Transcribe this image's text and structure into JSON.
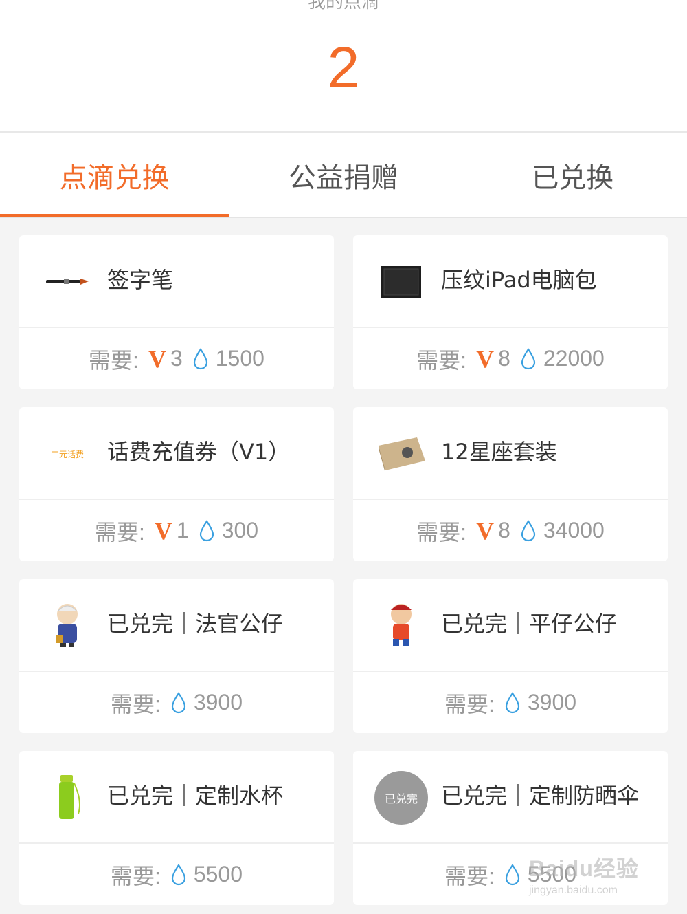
{
  "header": {
    "label": "我的点滴",
    "points": "2"
  },
  "tabs": [
    {
      "label": "点滴兑换",
      "active": true
    },
    {
      "label": "公益捐赠",
      "active": false
    },
    {
      "label": "已兑换",
      "active": false
    }
  ],
  "require_label": "需要:",
  "v_mark": "V",
  "items": [
    {
      "name": "签字笔",
      "icon": "pen-icon",
      "vip": "3",
      "drops": "1500"
    },
    {
      "name": "压纹iPad电脑包",
      "icon": "ipad-bag-icon",
      "vip": "8",
      "drops": "22000"
    },
    {
      "name": "话费充值券（V1）",
      "icon": "phone-credit-icon",
      "icon_text": "二元话费",
      "vip": "1",
      "drops": "300"
    },
    {
      "name": "12星座套装",
      "icon": "zodiac-box-icon",
      "vip": "8",
      "drops": "34000"
    },
    {
      "name": "已兑完｜法官公仔",
      "icon": "judge-doll-icon",
      "vip": null,
      "drops": "3900"
    },
    {
      "name": "已兑完｜平仔公仔",
      "icon": "pingzai-doll-icon",
      "vip": null,
      "drops": "3900"
    },
    {
      "name": "已兑完｜定制水杯",
      "icon": "water-bottle-icon",
      "vip": null,
      "drops": "5500"
    },
    {
      "name": "已兑完｜定制防晒伞",
      "icon": "umbrella-icon",
      "icon_text": "已兑完",
      "vip": null,
      "drops": "5500"
    }
  ],
  "watermark": {
    "line1": "Baidu经验",
    "line2": "jingyan.baidu.com"
  },
  "colors": {
    "accent": "#f26c2a",
    "drop": "#3aa0e0"
  }
}
